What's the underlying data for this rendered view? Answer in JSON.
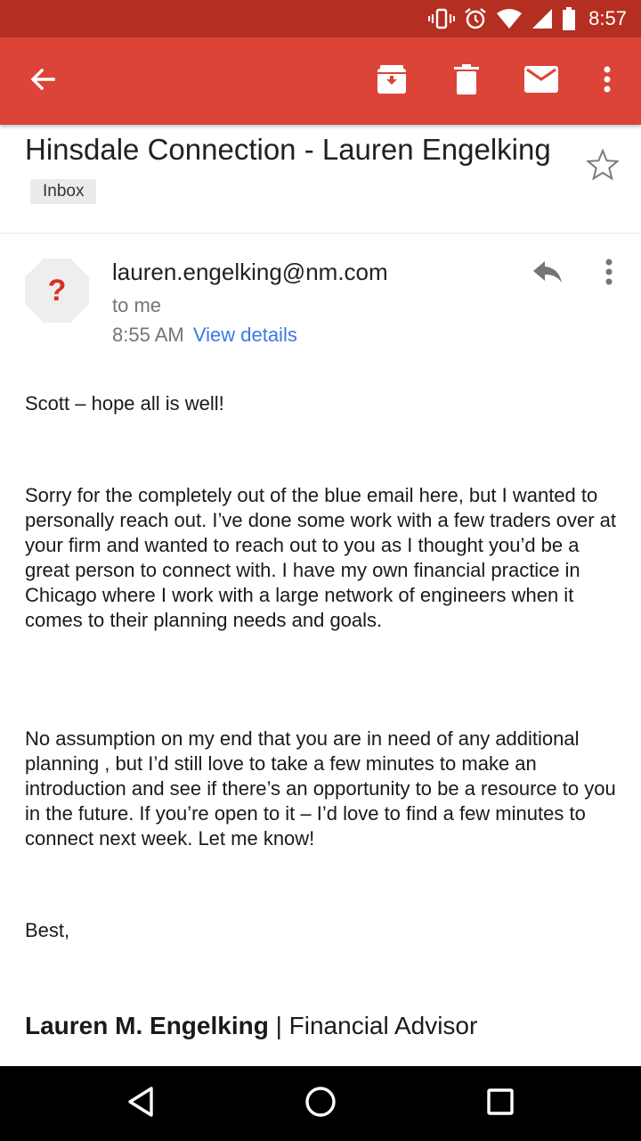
{
  "status_bar": {
    "time": "8:57",
    "icons": [
      "vibrate-icon",
      "alarm-icon",
      "wifi-icon",
      "signal-icon",
      "battery-icon"
    ]
  },
  "app_bar": {
    "color": "#db4437",
    "actions": [
      "back-arrow-icon",
      "archive-icon",
      "delete-icon",
      "mark-unread-icon",
      "more-vert-icon"
    ]
  },
  "email": {
    "subject": "Hinsdale Connection - Lauren Engelking",
    "label": "Inbox",
    "sender": {
      "email": "lauren.engelking@nm.com",
      "avatar_glyph": "?",
      "recipient": "to me",
      "time": "8:55 AM",
      "view_details": "View details"
    },
    "body": [
      "Scott – hope all is well!",
      "Sorry for the completely out of the blue email here, but I wanted to personally reach out.  I’ve done some work with a few traders over at your firm and wanted to reach out to you as I thought you’d be a great person to connect with.  I have my own financial practice in Chicago where I work with a large network of engineers when it comes to their planning needs and goals.",
      "No assumption on my end that you are in need of any additional planning , but I’d still love to take a few minutes to make an introduction and see if there’s an opportunity to be a resource to you in the future.  If you’re open to it – I’d love to find a few minutes to connect next week.  Let me know!",
      "Best,"
    ],
    "signature": {
      "name": "Lauren M. Engelking",
      "separator": " | ",
      "title": "Financial Advisor"
    }
  },
  "nav_bar": {
    "icons": [
      "nav-back-icon",
      "nav-home-icon",
      "nav-recents-icon"
    ]
  }
}
